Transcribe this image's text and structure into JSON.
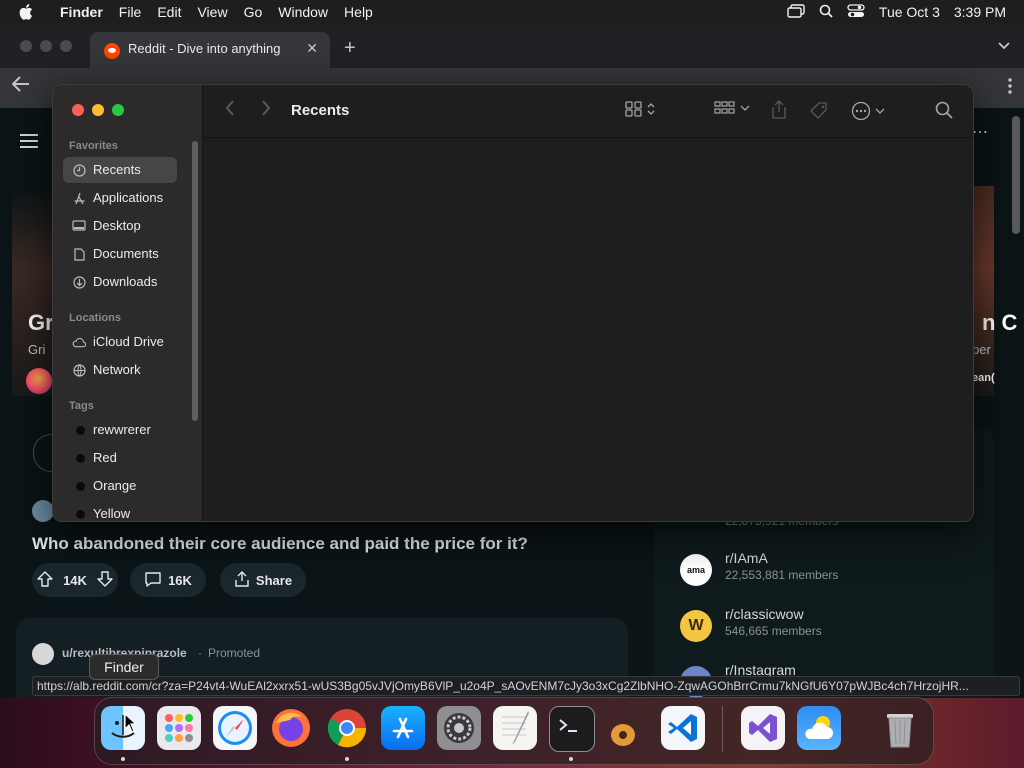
{
  "menubar": {
    "items": [
      "Finder",
      "File",
      "Edit",
      "View",
      "Go",
      "Window",
      "Help"
    ],
    "date": "Tue Oct 3",
    "time": "3:39 PM",
    "icons": [
      "apple-icon",
      "screen-mirror-icon",
      "spotlight-search-icon",
      "control-center-icon"
    ]
  },
  "browser": {
    "tab_title": "Reddit - Dive into anything",
    "tab_close": "✕",
    "new_tab": "+"
  },
  "reddit": {
    "banner_left_text": "Gr",
    "banner_left_sub": "Gri",
    "banner_right_text": "n C",
    "banner_right_sub": "per",
    "banner_right_sub2": "ean(",
    "post_title": "Who abandoned their core audience and paid the price for it?",
    "upvotes": "14K",
    "comments": "16K",
    "share_label": "Share",
    "promo_user": "u/rexulti...",
    "promo_user_full": "u/rexultibrexpiprazole",
    "promo_dot": "·",
    "promo_label": "Promoted",
    "partial_members": "22,875,921 members",
    "subreddits": [
      {
        "name": "r/IAmA",
        "members": "22,553,881 members",
        "icon": "ama-icon",
        "color": "#ffffff"
      },
      {
        "name": "r/classicwow",
        "members": "546,665 members",
        "icon": "wow-icon",
        "color": "#f4c542"
      },
      {
        "name": "r/Instagram",
        "members": "",
        "icon": "instagram-icon",
        "color": "#6a85c9"
      }
    ]
  },
  "status_url": "https://alb.reddit.com/cr?za=P24vt4-WuEAl2xxrx51-wUS3Bg05vJVjOmyB6VlP_u2o4P_sAOvENM7cJy3o3xCg2ZlbNHO-ZqwAGOhBrrCrmu7kNGfU6Y07pWJBc4ch7HrzojHR...",
  "finder": {
    "title": "Recents",
    "favorites_heading": "Favorites",
    "favorites": [
      {
        "label": "Recents",
        "icon": "clock-icon",
        "selected": true
      },
      {
        "label": "Applications",
        "icon": "applications-icon",
        "selected": false
      },
      {
        "label": "Desktop",
        "icon": "desktop-icon",
        "selected": false
      },
      {
        "label": "Documents",
        "icon": "document-icon",
        "selected": false
      },
      {
        "label": "Downloads",
        "icon": "download-icon",
        "selected": false
      }
    ],
    "locations_heading": "Locations",
    "locations": [
      {
        "label": "iCloud Drive",
        "icon": "cloud-icon"
      },
      {
        "label": "Network",
        "icon": "network-icon"
      }
    ],
    "tags_heading": "Tags",
    "tags": [
      {
        "label": "rewwrerer",
        "color": "#0a0a0a"
      },
      {
        "label": "Red",
        "color": "#0a0a0a"
      },
      {
        "label": "Orange",
        "color": "#0a0a0a"
      },
      {
        "label": "Yellow",
        "color": "#0a0a0a"
      }
    ],
    "toolbar_icons": [
      "icon-view-grid-icon",
      "group-by-icon",
      "share-icon",
      "tag-icon",
      "more-actions-icon",
      "search-icon"
    ]
  },
  "dock": {
    "tooltip": "Finder",
    "apps": [
      {
        "name": "Finder",
        "icon": "finder-icon",
        "running": true
      },
      {
        "name": "Launchpad",
        "icon": "launchpad-icon",
        "running": false
      },
      {
        "name": "Safari",
        "icon": "safari-icon",
        "running": false
      },
      {
        "name": "Firefox",
        "icon": "firefox-icon",
        "running": false
      },
      {
        "name": "Google Chrome",
        "icon": "chrome-icon",
        "running": true
      },
      {
        "name": "App Store",
        "icon": "app-store-icon",
        "running": false
      },
      {
        "name": "System Settings",
        "icon": "settings-icon",
        "running": false
      },
      {
        "name": "TextEdit",
        "icon": "textedit-icon",
        "running": false
      },
      {
        "name": "Terminal",
        "icon": "terminal-icon",
        "running": true
      },
      {
        "name": "GarageBand",
        "icon": "garageband-icon",
        "running": false
      },
      {
        "name": "Visual Studio Code",
        "icon": "vscode-icon",
        "running": false
      },
      {
        "name": "Visual Studio",
        "icon": "visual-studio-icon",
        "running": false
      },
      {
        "name": "Weather",
        "icon": "weather-icon",
        "running": false
      },
      {
        "name": "Trash",
        "icon": "trash-icon",
        "running": false
      }
    ]
  }
}
